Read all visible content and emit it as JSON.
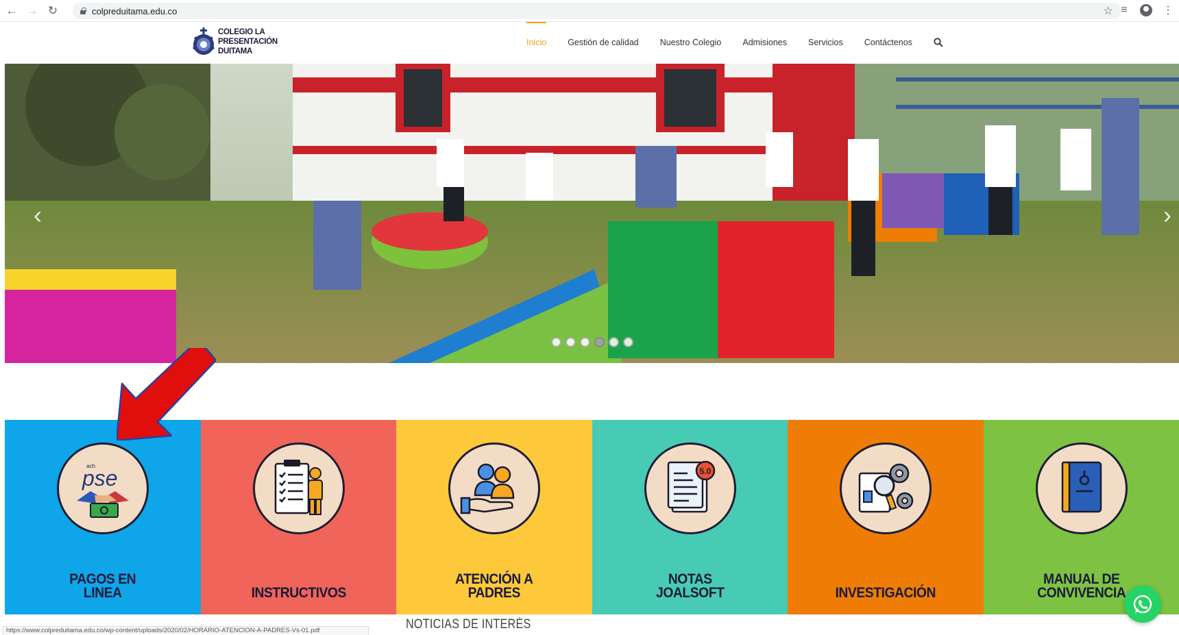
{
  "browser": {
    "url": "colpreduitama.edu.co",
    "status_url": "https://www.colpreduitama.edu.co/wp-content/uploads/2020/02/HORARIO-ATENCION-A-PADRES-Vs-01.pdf"
  },
  "site": {
    "logo_lines": [
      "COLEGIO LA",
      "PRESENTACIÓN",
      "DUITAMA"
    ],
    "menu": [
      {
        "label": "Inicio",
        "active": true
      },
      {
        "label": "Gestión de calidad",
        "active": false
      },
      {
        "label": "Nuestro Colegio",
        "active": false
      },
      {
        "label": "Admisiones",
        "active": false
      },
      {
        "label": "Servicios",
        "active": false
      },
      {
        "label": "Contáctenos",
        "active": false
      }
    ],
    "accent_color": "#f2a51a"
  },
  "hero": {
    "slide_count": 6,
    "active_slide": 3
  },
  "tiles": [
    {
      "label_lines": [
        "PAGOS EN",
        "LINEA"
      ],
      "color": "#0ea5e9",
      "icon": "pse-payment-icon"
    },
    {
      "label_lines": [
        "INSTRUCTIVOS"
      ],
      "color": "#f0645a",
      "icon": "checklist-person-icon"
    },
    {
      "label_lines": [
        "ATENCIÓN A",
        "PADRES"
      ],
      "color": "#fdc93a",
      "icon": "parents-hand-icon"
    },
    {
      "label_lines": [
        "NOTAS",
        "JOALSOFT"
      ],
      "color": "#48cbb4",
      "icon": "grade-document-icon"
    },
    {
      "label_lines": [
        "INVESTIGACIÓN"
      ],
      "color": "#ef7d05",
      "icon": "research-gears-icon"
    },
    {
      "label_lines": [
        "MANUAL DE",
        "CONVIVENCIA"
      ],
      "color": "#7dc242",
      "icon": "manual-book-icon"
    }
  ],
  "tile_badge": "5.0",
  "news": {
    "heading": "NOTICIAS DE INTERÉS"
  }
}
